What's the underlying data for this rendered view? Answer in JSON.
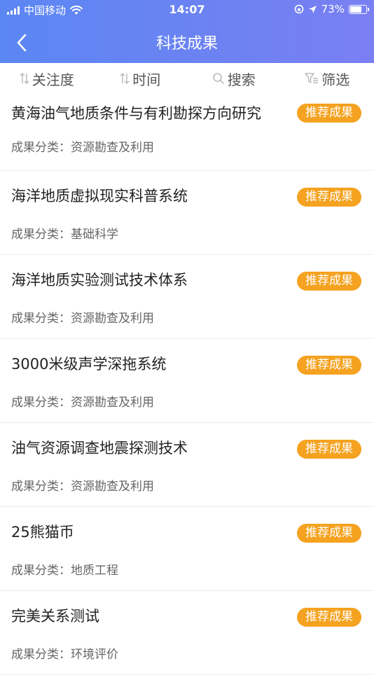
{
  "status_bar": {
    "carrier": "中国移动",
    "time": "14:07",
    "battery_percent": "73%",
    "battery_level": 0.73
  },
  "nav": {
    "title": "科技成果",
    "back_icon": "chevron-left-icon"
  },
  "filters": [
    {
      "label": "关注度",
      "icon": "sort-icon"
    },
    {
      "label": "时间",
      "icon": "sort-icon"
    },
    {
      "label": "搜索",
      "icon": "search-icon"
    },
    {
      "label": "筛选",
      "icon": "filter-icon"
    }
  ],
  "colors": {
    "header_start": "#5b87f3",
    "header_end": "#7a7ff2",
    "badge": "#f4a21f"
  },
  "items": [
    {
      "title": "黄海油气地质条件与有利勘探方向研究",
      "meta_label": "成果分类：",
      "meta_value": "资源勘查及利用",
      "badge": "推荐成果"
    },
    {
      "title": "海洋地质虚拟现实科普系统",
      "meta_label": "成果分类：",
      "meta_value": "基础科学",
      "badge": "推荐成果"
    },
    {
      "title": "海洋地质实验测试技术体系",
      "meta_label": "成果分类：",
      "meta_value": "资源勘查及利用",
      "badge": "推荐成果"
    },
    {
      "title": "3000米级声学深拖系统",
      "meta_label": "成果分类：",
      "meta_value": "资源勘查及利用",
      "badge": "推荐成果"
    },
    {
      "title": "油气资源调查地震探测技术",
      "meta_label": "成果分类：",
      "meta_value": "资源勘查及利用",
      "badge": "推荐成果"
    },
    {
      "title": "25熊猫币",
      "meta_label": "成果分类：",
      "meta_value": "地质工程",
      "badge": "推荐成果"
    },
    {
      "title": "完美关系测试",
      "meta_label": "成果分类：",
      "meta_value": "环境评价",
      "badge": "推荐成果"
    }
  ]
}
